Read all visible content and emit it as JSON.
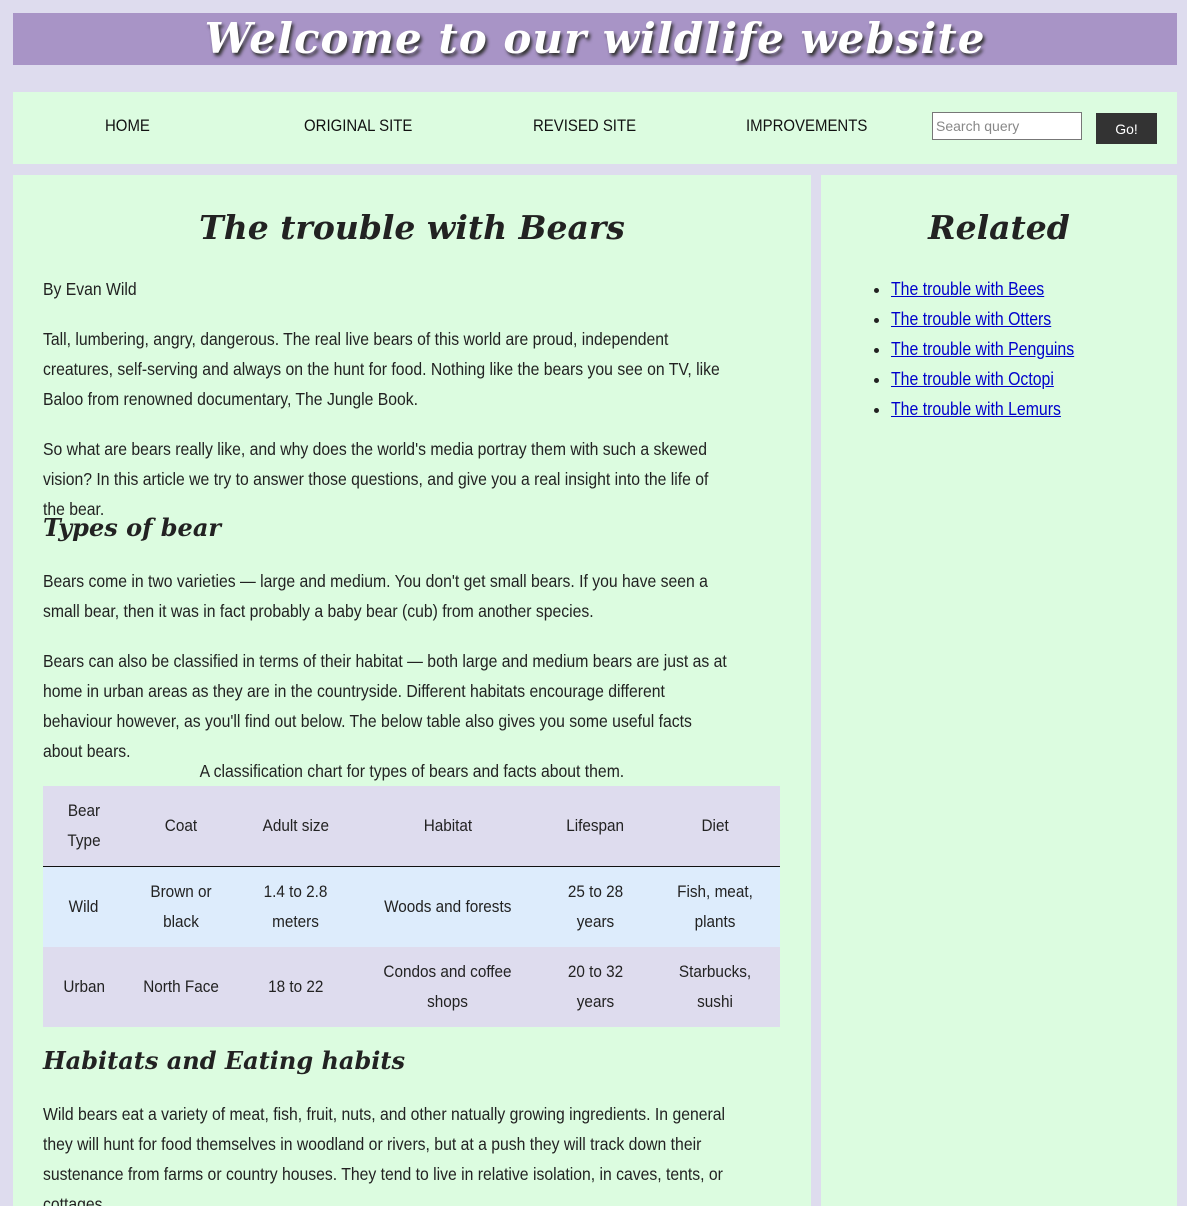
{
  "banner": {
    "title": "Welcome to our wildlife website"
  },
  "nav": {
    "links": [
      "HOME",
      "ORIGINAL SITE",
      "REVISED SITE",
      "IMPROVEMENTS"
    ],
    "search_placeholder": "Search query",
    "search_value": "",
    "go_label": "Go!"
  },
  "article": {
    "title": "The trouble with Bears",
    "byline": "By Evan Wild",
    "intro_paragraphs": [
      "Tall, lumbering, angry, dangerous. The real live bears of this world are proud, independent creatures, self-serving and always on the hunt for food. Nothing like the bears you see on TV, like Baloo from renowned documentary, The Jungle Book.",
      "So what are bears really like, and why does the world's media portray them with such a skewed vision? In this article we try to answer those questions, and give you a real insight into the life of the bear."
    ],
    "section1": {
      "heading": "Types of bear",
      "paragraphs": [
        "Bears come in two varieties — large and medium. You don't get small bears. If you have seen a small bear, then it was in fact probably a baby bear (cub) from another species.",
        "Bears can also be classified in terms of their habitat — both large and medium bears are just as at home in urban areas as they are in the countryside. Different habitats encourage different behaviour however, as you'll find out below. The below table also gives you some useful facts about bears."
      ]
    },
    "table": {
      "caption": "A classification chart for types of bears and facts about them.",
      "headers": [
        "Bear Type",
        "Coat",
        "Adult size",
        "Habitat",
        "Lifespan",
        "Diet"
      ],
      "rows": [
        [
          "Wild",
          "Brown or black",
          "1.4 to 2.8 meters",
          "Woods and forests",
          "25 to 28 years",
          "Fish, meat, plants"
        ],
        [
          "Urban",
          "North Face",
          "18 to 22",
          "Condos and coffee shops",
          "20 to 32 years",
          "Starbucks, sushi"
        ]
      ]
    },
    "section2": {
      "heading": "Habitats and Eating habits",
      "paragraph": "Wild bears eat a variety of meat, fish, fruit, nuts, and other natually growing ingredients. In general they will hunt for food themselves in woodland or rivers, but at a push they will track down their sustenance from farms or country houses. They tend to live in relative isolation, in caves, tents, or cottages."
    }
  },
  "sidebar": {
    "title": "Related",
    "links": [
      "The trouble with Bees",
      "The trouble with Otters",
      "The trouble with Penguins",
      "The trouble with Octopi",
      "The trouble with Lemurs"
    ]
  },
  "colors": {
    "page_background": "#dedcee",
    "banner_background": "#a894c6",
    "panel_background": "#dcfce0",
    "table_header_row": "#dedcee",
    "table_row_wild": "#ddecfc",
    "table_row_urban": "#dedcee",
    "link": "#0000cc",
    "button_background": "#333333"
  }
}
